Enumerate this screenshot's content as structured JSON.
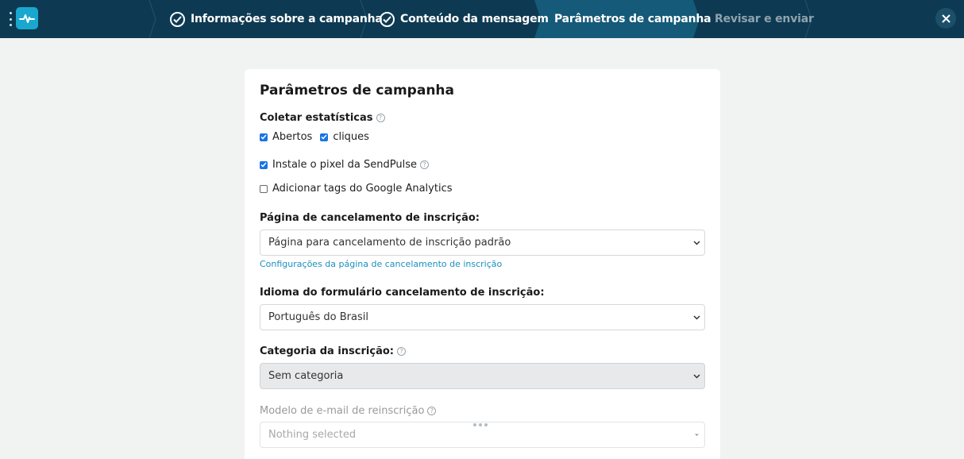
{
  "steps": [
    {
      "label": "Informações sobre a campanha",
      "state": "done"
    },
    {
      "label": "Conteúdo da mensagem",
      "state": "done"
    },
    {
      "label": "Parâmetros de campanha",
      "state": "active"
    },
    {
      "label": "Revisar e enviar",
      "state": "pending"
    }
  ],
  "colors": {
    "topbar": "#0d3a52",
    "active_step": "#155a78",
    "accent": "#19a7cf",
    "link": "#1b8fc0",
    "checkbox": "#1a73e8"
  },
  "card": {
    "title": "Parâmetros de campanha",
    "stats": {
      "label": "Coletar estatísticas",
      "opens": {
        "label": "Abertos",
        "checked": true
      },
      "clicks": {
        "label": "cliques",
        "checked": true
      }
    },
    "pixel": {
      "label": "Instale o pixel da SendPulse",
      "checked": true
    },
    "ga_tags": {
      "label": "Adicionar tags do Google Analytics",
      "checked": false
    },
    "unsubscribe_page": {
      "label": "Página de cancelamento de inscrição:",
      "value": "Página para cancelamento de inscrição padrão",
      "link": "Configurações da página de cancelamento de inscrição"
    },
    "unsubscribe_language": {
      "label": "Idioma do formulário cancelamento de inscrição:",
      "value": "Português do Brasil"
    },
    "category": {
      "label": "Categoria da inscrição:",
      "value": "Sem categoria"
    },
    "resubscribe_template": {
      "label": "Modelo de e-mail de reinscrição",
      "placeholder": "Nothing selected"
    }
  },
  "icons": {
    "menu": "vertical-dots-icon",
    "logo": "pulse-logo-icon",
    "check": "check-circle-icon",
    "help": "question-circle-icon",
    "close": "close-icon",
    "dropdown": "chevron-down-icon"
  }
}
